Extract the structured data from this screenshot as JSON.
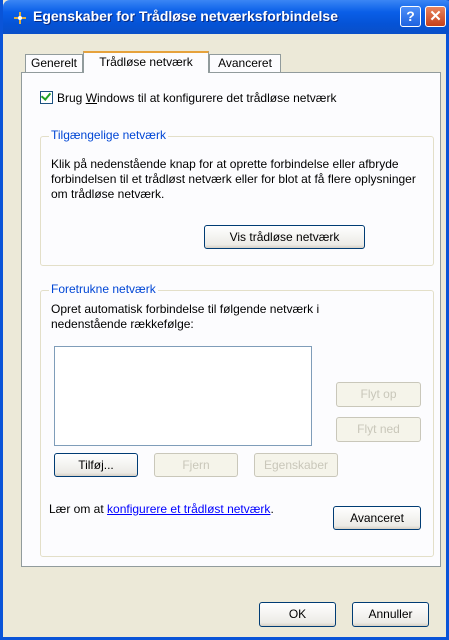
{
  "window": {
    "title": "Egenskaber for Trådløse netværksforbindelse",
    "icon": "network-connection-icon",
    "help_label": "?",
    "close_label": "✕"
  },
  "tabs": [
    {
      "label": "Generelt",
      "active": false
    },
    {
      "label": "Trådløse netværk",
      "active": true
    },
    {
      "label": "Avanceret",
      "active": false
    }
  ],
  "checkbox": {
    "label_pre": "Brug ",
    "label_u": "W",
    "label_post": "indows til at konfigurere det trådløse netværk",
    "checked": true
  },
  "available": {
    "title": "Tilgængelige netværk",
    "description": "Klik på nedenstående knap for at oprette forbindelse eller afbryde forbindelsen til et trådløst netværk eller for blot at få flere oplysninger om trådløse netværk.",
    "button_label": "Vis trådløse netværk"
  },
  "preferred": {
    "title": "Foretrukne netværk",
    "description": "Opret automatisk forbindelse til følgende netværk i nedenstående rækkefølge:",
    "items": [],
    "move_up_label": "Flyt op",
    "move_down_label": "Flyt ned",
    "add_label": "Tilføj...",
    "remove_label": "Fjern",
    "properties_label": "Egenskaber"
  },
  "learn": {
    "prefix": "Lær om at ",
    "link_text": "konfigurere et trådløst netværk",
    "suffix": "."
  },
  "advanced_button_label": "Avanceret",
  "footer": {
    "ok_label": "OK",
    "cancel_label": "Annuller"
  }
}
